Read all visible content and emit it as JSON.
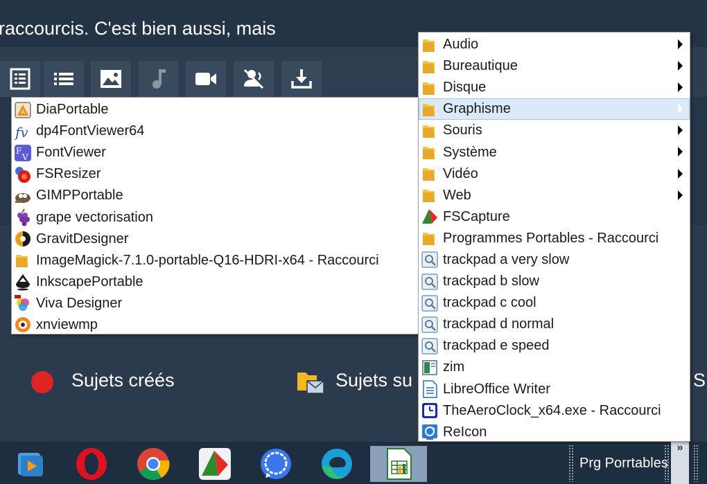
{
  "header": {
    "text": "raccourcis. C'est bien aussi, mais"
  },
  "toolbar": {
    "icons": [
      "list-detail-icon",
      "list-icon",
      "image-icon",
      "music-icon",
      "video-icon",
      "mute-icon",
      "download-icon"
    ]
  },
  "content": {
    "subjects_created": "Sujets créés",
    "subjects_followed": "Sujets su",
    "subjects_other": "S"
  },
  "left_menu": {
    "items": [
      {
        "label": "DiaPortable",
        "icon": "dia-icon"
      },
      {
        "label": "dp4FontViewer64",
        "icon": "font-viewer-script-icon"
      },
      {
        "label": "FontViewer",
        "icon": "fontviewer-icon"
      },
      {
        "label": "FSResizer",
        "icon": "fsresizer-icon"
      },
      {
        "label": "GIMPPortable",
        "icon": "gimp-icon"
      },
      {
        "label": "grape vectorisation",
        "icon": "grape-icon"
      },
      {
        "label": "GravitDesigner",
        "icon": "gravit-icon"
      },
      {
        "label": "ImageMagick-7.1.0-portable-Q16-HDRI-x64 - Raccourci",
        "icon": "folder-icon"
      },
      {
        "label": "InkscapePortable",
        "icon": "inkscape-icon"
      },
      {
        "label": "Viva Designer",
        "icon": "viva-icon"
      },
      {
        "label": "xnviewmp",
        "icon": "xnview-icon"
      }
    ]
  },
  "right_menu": {
    "items": [
      {
        "label": "Audio",
        "icon": "folder-icon",
        "submenu": true
      },
      {
        "label": "Bureautique",
        "icon": "folder-icon",
        "submenu": true
      },
      {
        "label": "Disque",
        "icon": "folder-icon",
        "submenu": true
      },
      {
        "label": "Graphisme",
        "icon": "folder-icon",
        "submenu": true,
        "highlighted": true
      },
      {
        "label": "Souris",
        "icon": "folder-icon",
        "submenu": true
      },
      {
        "label": "Système",
        "icon": "folder-icon",
        "submenu": true
      },
      {
        "label": "Vidéo",
        "icon": "folder-icon",
        "submenu": true
      },
      {
        "label": "Web",
        "icon": "folder-icon",
        "submenu": true
      },
      {
        "label": "FSCapture",
        "icon": "fscapture-icon"
      },
      {
        "label": "Programmes Portables - Raccourci",
        "icon": "folder-icon"
      },
      {
        "label": "trackpad a very slow",
        "icon": "shortcut-settings-icon"
      },
      {
        "label": "trackpad b slow",
        "icon": "shortcut-settings-icon"
      },
      {
        "label": "trackpad c cool",
        "icon": "shortcut-settings-icon"
      },
      {
        "label": "trackpad d normal",
        "icon": "shortcut-settings-icon"
      },
      {
        "label": "trackpad e speed",
        "icon": "shortcut-settings-icon"
      },
      {
        "label": "zim",
        "icon": "zim-icon"
      },
      {
        "label": "LibreOffice Writer",
        "icon": "writer-icon"
      },
      {
        "label": "TheAeroClock_x64.exe - Raccourci",
        "icon": "clock-icon"
      },
      {
        "label": "ReIcon",
        "icon": "reicon-icon"
      }
    ]
  },
  "taskbar": {
    "apps": [
      "media-player-icon",
      "opera-icon",
      "chrome-icon",
      "fscapture-icon",
      "signal-icon",
      "edge-icon",
      "libreoffice-calc-icon"
    ],
    "label": "Prg Porrtables",
    "chevron": "»"
  },
  "colors": {
    "background": "#2b3a4c",
    "menu_highlight": "#dceaf8",
    "folder": "#f5c542",
    "record_red": "#e02424"
  }
}
